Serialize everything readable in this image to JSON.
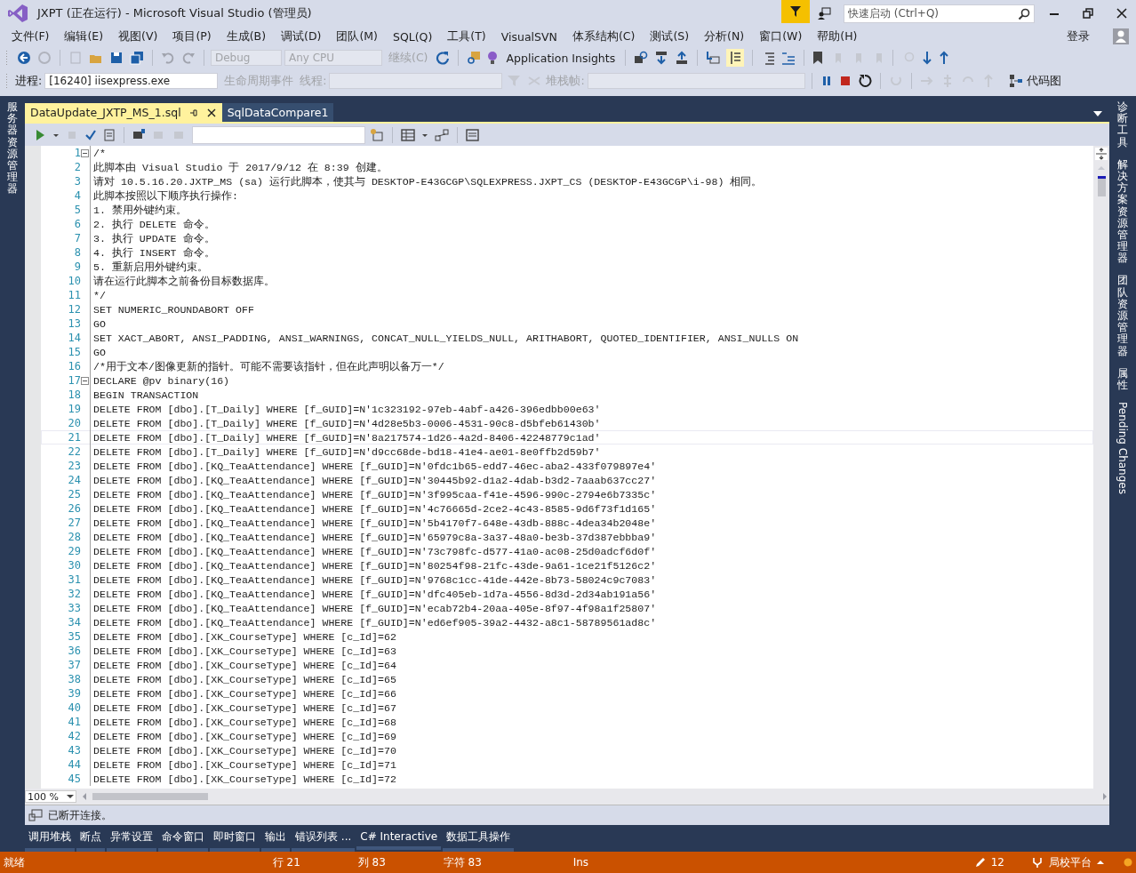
{
  "window": {
    "title": "JXPT (正在运行) - Microsoft Visual Studio (管理员)",
    "quick_launch": {
      "placeholder": "快速启动 (Ctrl+Q)"
    },
    "sign_in": "登录"
  },
  "menu": [
    "文件(F)",
    "编辑(E)",
    "视图(V)",
    "项目(P)",
    "生成(B)",
    "调试(D)",
    "团队(M)",
    "SQL(Q)",
    "工具(T)",
    "VisualSVN",
    "体系结构(C)",
    "测试(S)",
    "分析(N)",
    "窗口(W)",
    "帮助(H)"
  ],
  "toolbar": {
    "configuration": {
      "text": "Debug",
      "disabled": true
    },
    "platform": {
      "text": "Any CPU",
      "disabled": true
    },
    "continue": {
      "text": "继续(C)",
      "disabled": true
    },
    "insights": {
      "text": "Application Insights",
      "disabled": false
    }
  },
  "debug_toolbar": {
    "process_label": "进程:",
    "process": "[16240] iisexpress.exe",
    "lifecycle": {
      "text": "生命周期事件",
      "disabled": true
    },
    "thread_label": "线程:",
    "stack_label": "堆栈帧:",
    "code_map": "代码图"
  },
  "left_sidebar": [
    {
      "label": "服务器资源管理器",
      "kind": "stacked"
    }
  ],
  "right_sidebar": [
    {
      "label": "诊断工具",
      "kind": "stacked"
    },
    {
      "label": "解决方案资源管理器",
      "kind": "stacked"
    },
    {
      "label": "团队资源管理器",
      "kind": "stacked"
    },
    {
      "label": "属性",
      "kind": "stacked"
    },
    {
      "label": "Pending Changes",
      "kind": "rotated"
    }
  ],
  "tabs": [
    {
      "label": "DataUpdate_JXTP_MS_1.sql",
      "selected": true
    },
    {
      "label": "SqlDataCompare1",
      "selected": false
    }
  ],
  "editor": {
    "zoom": "100 %",
    "connection_status": "已断开连接。",
    "lines": [
      {
        "n": "1",
        "text": "/*",
        "fold": true,
        "current": false
      },
      {
        "n": "2",
        "text": "此脚本由 Visual Studio 于 2017/9/12 在 8:39 创建。",
        "fold": false,
        "current": false
      },
      {
        "n": "3",
        "text": "请对 10.5.16.20.JXTP_MS (sa) 运行此脚本，使其与 DESKTOP-E43GCGP\\SQLEXPRESS.JXPT_CS (DESKTOP-E43GCGP\\i-98) 相同。",
        "fold": false,
        "current": false
      },
      {
        "n": "4",
        "text": "此脚本按照以下顺序执行操作:",
        "fold": false,
        "current": false
      },
      {
        "n": "5",
        "text": "1. 禁用外键约束。",
        "fold": false,
        "current": false
      },
      {
        "n": "6",
        "text": "2. 执行 DELETE 命令。",
        "fold": false,
        "current": false
      },
      {
        "n": "7",
        "text": "3. 执行 UPDATE 命令。",
        "fold": false,
        "current": false
      },
      {
        "n": "8",
        "text": "4. 执行 INSERT 命令。",
        "fold": false,
        "current": false
      },
      {
        "n": "9",
        "text": "5. 重新启用外键约束。",
        "fold": false,
        "current": false
      },
      {
        "n": "10",
        "text": "请在运行此脚本之前备份目标数据库。",
        "fold": false,
        "current": false
      },
      {
        "n": "11",
        "text": "*/",
        "fold": false,
        "current": false
      },
      {
        "n": "12",
        "text": "SET NUMERIC_ROUNDABORT OFF",
        "fold": false,
        "current": false
      },
      {
        "n": "13",
        "text": "GO",
        "fold": false,
        "current": false
      },
      {
        "n": "14",
        "text": "SET XACT_ABORT, ANSI_PADDING, ANSI_WARNINGS, CONCAT_NULL_YIELDS_NULL, ARITHABORT, QUOTED_IDENTIFIER, ANSI_NULLS ON",
        "fold": false,
        "current": false
      },
      {
        "n": "15",
        "text": "GO",
        "fold": false,
        "current": false
      },
      {
        "n": "16",
        "text": "/*用于文本/图像更新的指针。可能不需要该指针，但在此声明以备万一*/",
        "fold": false,
        "current": false
      },
      {
        "n": "17",
        "text": "DECLARE @pv binary(16)",
        "fold": true,
        "current": false
      },
      {
        "n": "18",
        "text": "BEGIN TRANSACTION",
        "fold": false,
        "current": false
      },
      {
        "n": "19",
        "text": "DELETE FROM [dbo].[T_Daily] WHERE [f_GUID]=N'1c323192-97eb-4abf-a426-396edbb00e63'",
        "fold": false,
        "current": false
      },
      {
        "n": "20",
        "text": "DELETE FROM [dbo].[T_Daily] WHERE [f_GUID]=N'4d28e5b3-0006-4531-90c8-d5bfeb61430b'",
        "fold": false,
        "current": false
      },
      {
        "n": "21",
        "text": "DELETE FROM [dbo].[T_Daily] WHERE [f_GUID]=N'8a217574-1d26-4a2d-8406-42248779c1ad'",
        "fold": false,
        "current": true
      },
      {
        "n": "22",
        "text": "DELETE FROM [dbo].[T_Daily] WHERE [f_GUID]=N'd9cc68de-bd18-41e4-ae01-8e0ffb2d59b7'",
        "fold": false,
        "current": false
      },
      {
        "n": "23",
        "text": "DELETE FROM [dbo].[KQ_TeaAttendance] WHERE [f_GUID]=N'0fdc1b65-edd7-46ec-aba2-433f079897e4'",
        "fold": false,
        "current": false
      },
      {
        "n": "24",
        "text": "DELETE FROM [dbo].[KQ_TeaAttendance] WHERE [f_GUID]=N'30445b92-d1a2-4dab-b3d2-7aaab637cc27'",
        "fold": false,
        "current": false
      },
      {
        "n": "25",
        "text": "DELETE FROM [dbo].[KQ_TeaAttendance] WHERE [f_GUID]=N'3f995caa-f41e-4596-990c-2794e6b7335c'",
        "fold": false,
        "current": false
      },
      {
        "n": "26",
        "text": "DELETE FROM [dbo].[KQ_TeaAttendance] WHERE [f_GUID]=N'4c76665d-2ce2-4c43-8585-9d6f73f1d165'",
        "fold": false,
        "current": false
      },
      {
        "n": "27",
        "text": "DELETE FROM [dbo].[KQ_TeaAttendance] WHERE [f_GUID]=N'5b4170f7-648e-43db-888c-4dea34b2048e'",
        "fold": false,
        "current": false
      },
      {
        "n": "28",
        "text": "DELETE FROM [dbo].[KQ_TeaAttendance] WHERE [f_GUID]=N'65979c8a-3a37-48a0-be3b-37d387ebbba9'",
        "fold": false,
        "current": false
      },
      {
        "n": "29",
        "text": "DELETE FROM [dbo].[KQ_TeaAttendance] WHERE [f_GUID]=N'73c798fc-d577-41a0-ac08-25d0adcf6d0f'",
        "fold": false,
        "current": false
      },
      {
        "n": "30",
        "text": "DELETE FROM [dbo].[KQ_TeaAttendance] WHERE [f_GUID]=N'80254f98-21fc-43de-9a61-1ce21f5126c2'",
        "fold": false,
        "current": false
      },
      {
        "n": "31",
        "text": "DELETE FROM [dbo].[KQ_TeaAttendance] WHERE [f_GUID]=N'9768c1cc-41de-442e-8b73-58024c9c7083'",
        "fold": false,
        "current": false
      },
      {
        "n": "32",
        "text": "DELETE FROM [dbo].[KQ_TeaAttendance] WHERE [f_GUID]=N'dfc405eb-1d7a-4556-8d3d-2d34ab191a56'",
        "fold": false,
        "current": false
      },
      {
        "n": "33",
        "text": "DELETE FROM [dbo].[KQ_TeaAttendance] WHERE [f_GUID]=N'ecab72b4-20aa-405e-8f97-4f98a1f25807'",
        "fold": false,
        "current": false
      },
      {
        "n": "34",
        "text": "DELETE FROM [dbo].[KQ_TeaAttendance] WHERE [f_GUID]=N'ed6ef905-39a2-4432-a8c1-58789561ad8c'",
        "fold": false,
        "current": false
      },
      {
        "n": "35",
        "text": "DELETE FROM [dbo].[XK_CourseType] WHERE [c_Id]=62",
        "fold": false,
        "current": false
      },
      {
        "n": "36",
        "text": "DELETE FROM [dbo].[XK_CourseType] WHERE [c_Id]=63",
        "fold": false,
        "current": false
      },
      {
        "n": "37",
        "text": "DELETE FROM [dbo].[XK_CourseType] WHERE [c_Id]=64",
        "fold": false,
        "current": false
      },
      {
        "n": "38",
        "text": "DELETE FROM [dbo].[XK_CourseType] WHERE [c_Id]=65",
        "fold": false,
        "current": false
      },
      {
        "n": "39",
        "text": "DELETE FROM [dbo].[XK_CourseType] WHERE [c_Id]=66",
        "fold": false,
        "current": false
      },
      {
        "n": "40",
        "text": "DELETE FROM [dbo].[XK_CourseType] WHERE [c_Id]=67",
        "fold": false,
        "current": false
      },
      {
        "n": "41",
        "text": "DELETE FROM [dbo].[XK_CourseType] WHERE [c_Id]=68",
        "fold": false,
        "current": false
      },
      {
        "n": "42",
        "text": "DELETE FROM [dbo].[XK_CourseType] WHERE [c_Id]=69",
        "fold": false,
        "current": false
      },
      {
        "n": "43",
        "text": "DELETE FROM [dbo].[XK_CourseType] WHERE [c_Id]=70",
        "fold": false,
        "current": false
      },
      {
        "n": "44",
        "text": "DELETE FROM [dbo].[XK_CourseType] WHERE [c_Id]=71",
        "fold": false,
        "current": false
      },
      {
        "n": "45",
        "text": "DELETE FROM [dbo].[XK_CourseType] WHERE [c_Id]=72",
        "fold": false,
        "current": false
      }
    ]
  },
  "tool_tabs": [
    "调用堆栈",
    "断点",
    "异常设置",
    "命令窗口",
    "即时窗口",
    "输出",
    "错误列表 ...",
    "C# Interactive",
    "数据工具操作"
  ],
  "status_bar": {
    "ready": "就绪",
    "line": "行 21",
    "column": "列 83",
    "char": "字符 83",
    "mode": "Ins",
    "edits": "12",
    "branch": "局校平台"
  }
}
